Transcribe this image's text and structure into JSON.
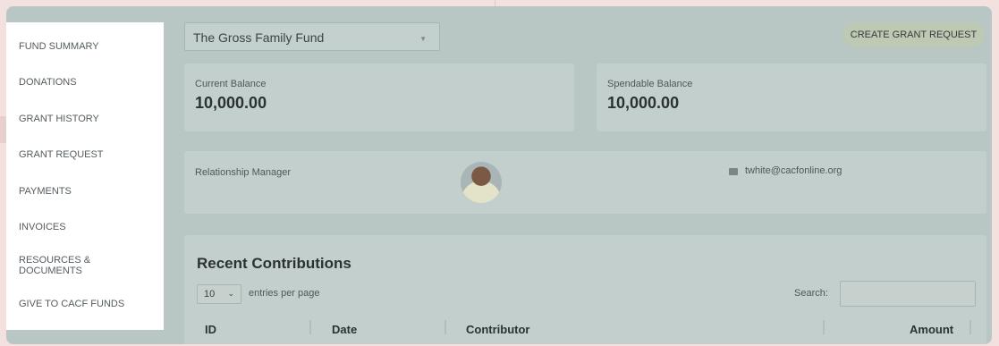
{
  "sidebar": {
    "items": [
      {
        "label": "FUND SUMMARY"
      },
      {
        "label": "DONATIONS"
      },
      {
        "label": "GRANT HISTORY"
      },
      {
        "label": "GRANT REQUEST"
      },
      {
        "label": "PAYMENTS"
      },
      {
        "label": "INVOICES"
      },
      {
        "label": "RESOURCES & DOCUMENTS"
      },
      {
        "label": "GIVE TO CACF FUNDS"
      }
    ]
  },
  "header": {
    "fund_select": "The Gross Family Fund",
    "create_button": "CREATE GRANT REQUEST"
  },
  "balances": {
    "current_label": "Current Balance",
    "current_value": "10,000.00",
    "spendable_label": "Spendable Balance",
    "spendable_value": "10,000.00"
  },
  "relationship": {
    "label": "Relationship Manager",
    "email": "twhite@cacfonline.org"
  },
  "contributions": {
    "title": "Recent Contributions",
    "entries_value": "10",
    "entries_label": "entries per page",
    "search_label": "Search:",
    "columns": [
      "ID",
      "Date",
      "Contributor",
      "Amount"
    ]
  },
  "colors": {
    "overlay": "#b9c7c4",
    "background": "#f3e1df"
  }
}
